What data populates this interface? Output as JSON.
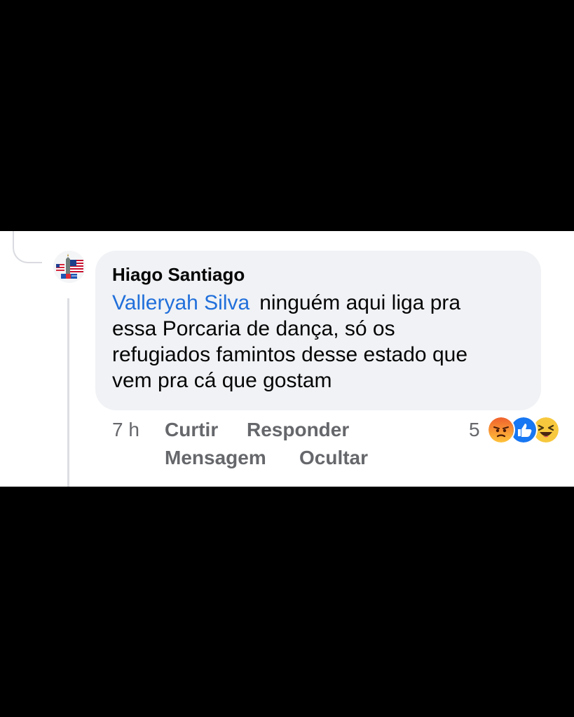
{
  "comment": {
    "author": "Hiago Santiago",
    "mention": "Valleryah Silva",
    "text_lines": [
      "ninguém aqui liga pra",
      "essa Porcaria de dança, só os",
      "refugiados famintos desse estado que",
      "vem pra cá que gostam"
    ]
  },
  "actions": {
    "time": "7 h",
    "like": "Curtir",
    "reply": "Responder",
    "message": "Mensagem",
    "hide": "Ocultar"
  },
  "reactions": {
    "count": "5",
    "types": [
      "angry-reaction-icon",
      "like-reaction-icon",
      "haha-reaction-icon"
    ]
  },
  "colors": {
    "mention": "#216fdb",
    "bubble": "#f0f2f5",
    "meta": "#65676b",
    "like": "#1877f2",
    "angry": "#f0612d"
  }
}
